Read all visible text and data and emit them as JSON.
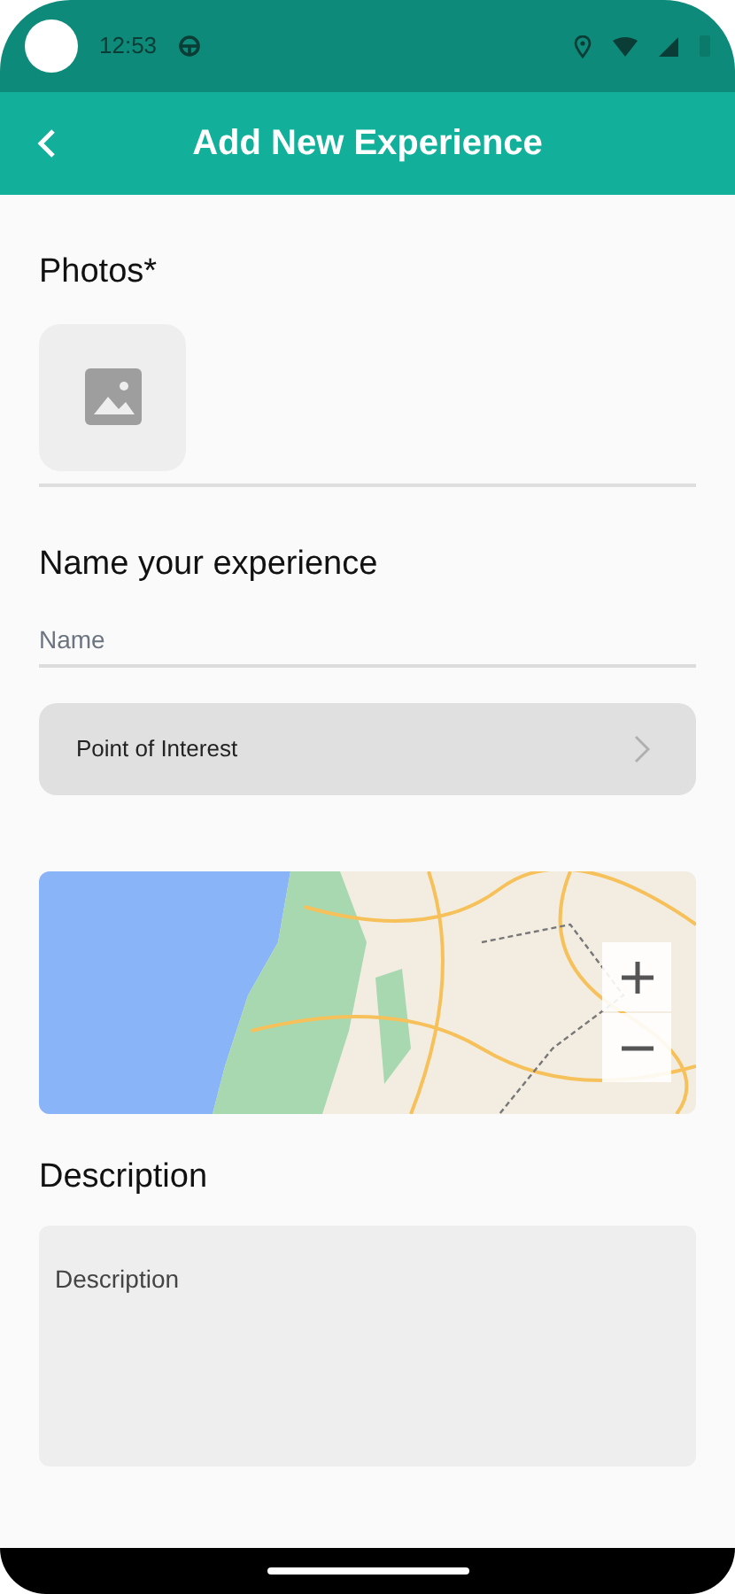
{
  "status_bar": {
    "time": "12:53"
  },
  "header": {
    "title": "Add New Experience"
  },
  "photos": {
    "label": "Photos*"
  },
  "name_section": {
    "label": "Name your experience",
    "placeholder": "Name"
  },
  "point_of_interest": {
    "label": "Point of Interest"
  },
  "description": {
    "label": "Description",
    "placeholder": "Description"
  }
}
